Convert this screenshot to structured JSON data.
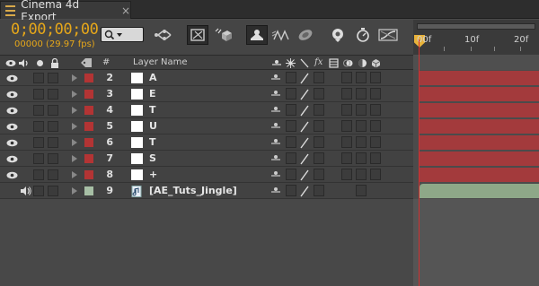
{
  "tab": {
    "title": "Cinema 4d Export",
    "close": "×"
  },
  "toolbar": {
    "timecode": "0;00;00;00",
    "fps_text": "00000 (29.97 fps)",
    "search_icon": "search-icon"
  },
  "ruler": {
    "labels": [
      "00f",
      "10f",
      "20f"
    ]
  },
  "columns": {
    "name": "Layer Name",
    "num": "#",
    "fx": "fx"
  },
  "layers": [
    {
      "num": "2",
      "name": "A",
      "color": "#b33434",
      "bar": "red"
    },
    {
      "num": "3",
      "name": "E",
      "color": "#b33434",
      "bar": "red"
    },
    {
      "num": "4",
      "name": "T",
      "color": "#b33434",
      "bar": "red"
    },
    {
      "num": "5",
      "name": "U",
      "color": "#b33434",
      "bar": "red"
    },
    {
      "num": "6",
      "name": "T",
      "color": "#b33434",
      "bar": "red"
    },
    {
      "num": "7",
      "name": "S",
      "color": "#b33434",
      "bar": "red"
    },
    {
      "num": "8",
      "name": "+",
      "color": "#b33434",
      "bar": "red"
    },
    {
      "num": "9",
      "name": "[AE_Tuts_Jingle]",
      "color": "#a7bfa5",
      "bar": "green",
      "audio": true
    }
  ],
  "colors": {
    "accent": "#e6a71a",
    "layer_bar_red": "#a33a3c",
    "audio_bar": "#8ea888",
    "cti": "#d03030"
  }
}
